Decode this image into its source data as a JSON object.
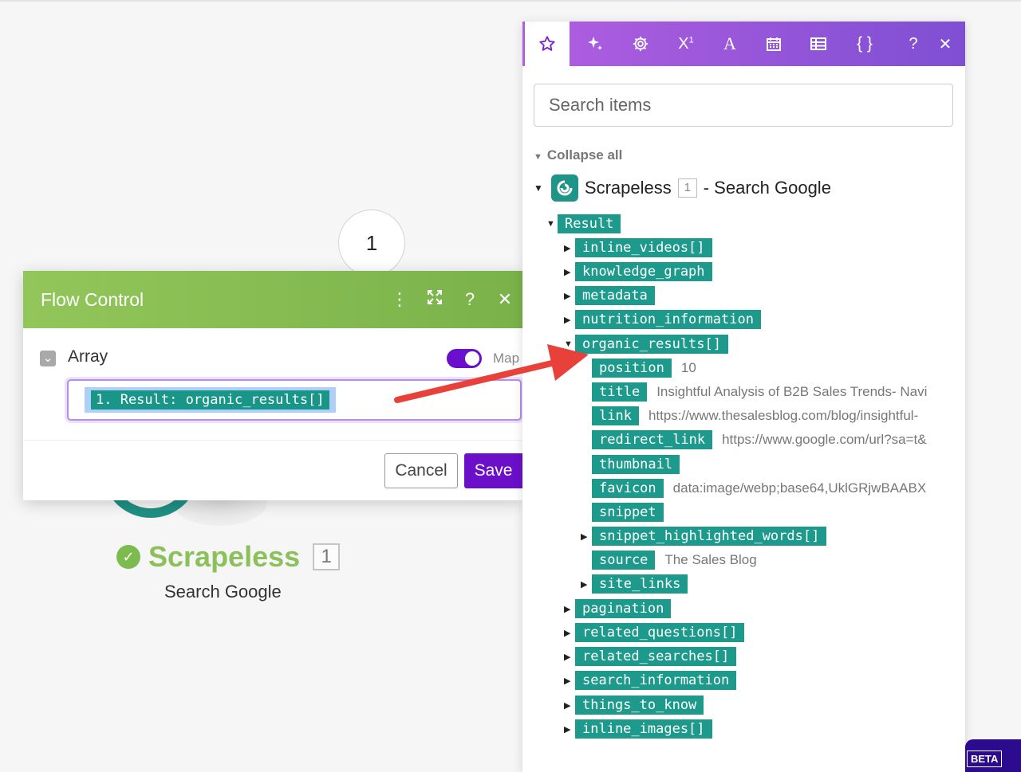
{
  "canvas": {
    "operation_number": "1",
    "module_title": "Scrapeless",
    "module_badge": "1",
    "module_subtitle": "Search Google"
  },
  "dialog": {
    "title": "Flow Control",
    "field_label": "Array",
    "map_label": "Map",
    "mapped_value": "1. Result: organic_results[]",
    "cancel_label": "Cancel",
    "save_label": "Save"
  },
  "panel": {
    "tabs": [
      "star-icon",
      "sparkle-icon",
      "gear-icon",
      "superscript-icon",
      "text-icon",
      "calendar-icon",
      "table-icon",
      "braces-icon"
    ],
    "help_label": "?",
    "search_placeholder": "Search items",
    "collapse_label": "Collapse all",
    "module_name": "Scrapeless",
    "module_badge": "1",
    "module_suffix": "- Search Google",
    "root_label": "Result",
    "items": [
      {
        "label": "inline_videos[]",
        "expander": "closed"
      },
      {
        "label": "knowledge_graph",
        "expander": "closed"
      },
      {
        "label": "metadata",
        "expander": "closed"
      },
      {
        "label": "nutrition_information",
        "expander": "closed"
      },
      {
        "label": "organic_results[]",
        "expander": "open"
      },
      {
        "label": "position",
        "value": "10"
      },
      {
        "label": "title",
        "value": "Insightful Analysis of B2B Sales Trends- Navi"
      },
      {
        "label": "link",
        "value": "https://www.thesalesblog.com/blog/insightful-"
      },
      {
        "label": "redirect_link",
        "value": "https://www.google.com/url?sa=t&"
      },
      {
        "label": "thumbnail"
      },
      {
        "label": "favicon",
        "value": "data:image/webp;base64,UklGRjwBAABX"
      },
      {
        "label": "snippet"
      },
      {
        "label": "snippet_highlighted_words[]",
        "expander": "closed"
      },
      {
        "label": "source",
        "value": "The Sales Blog"
      },
      {
        "label": "site_links",
        "expander": "closed"
      },
      {
        "label": "pagination",
        "expander": "closed"
      },
      {
        "label": "related_questions[]",
        "expander": "closed"
      },
      {
        "label": "related_searches[]",
        "expander": "closed"
      },
      {
        "label": "search_information",
        "expander": "closed"
      },
      {
        "label": "things_to_know",
        "expander": "closed"
      },
      {
        "label": "inline_images[]",
        "expander": "closed"
      }
    ]
  },
  "beta_label": "BETA",
  "colors": {
    "accent_purple": "#6b0fc9",
    "pill_teal": "#1d9a8b",
    "header_green": "#8cc05a",
    "arrow_red": "#e8413a"
  }
}
